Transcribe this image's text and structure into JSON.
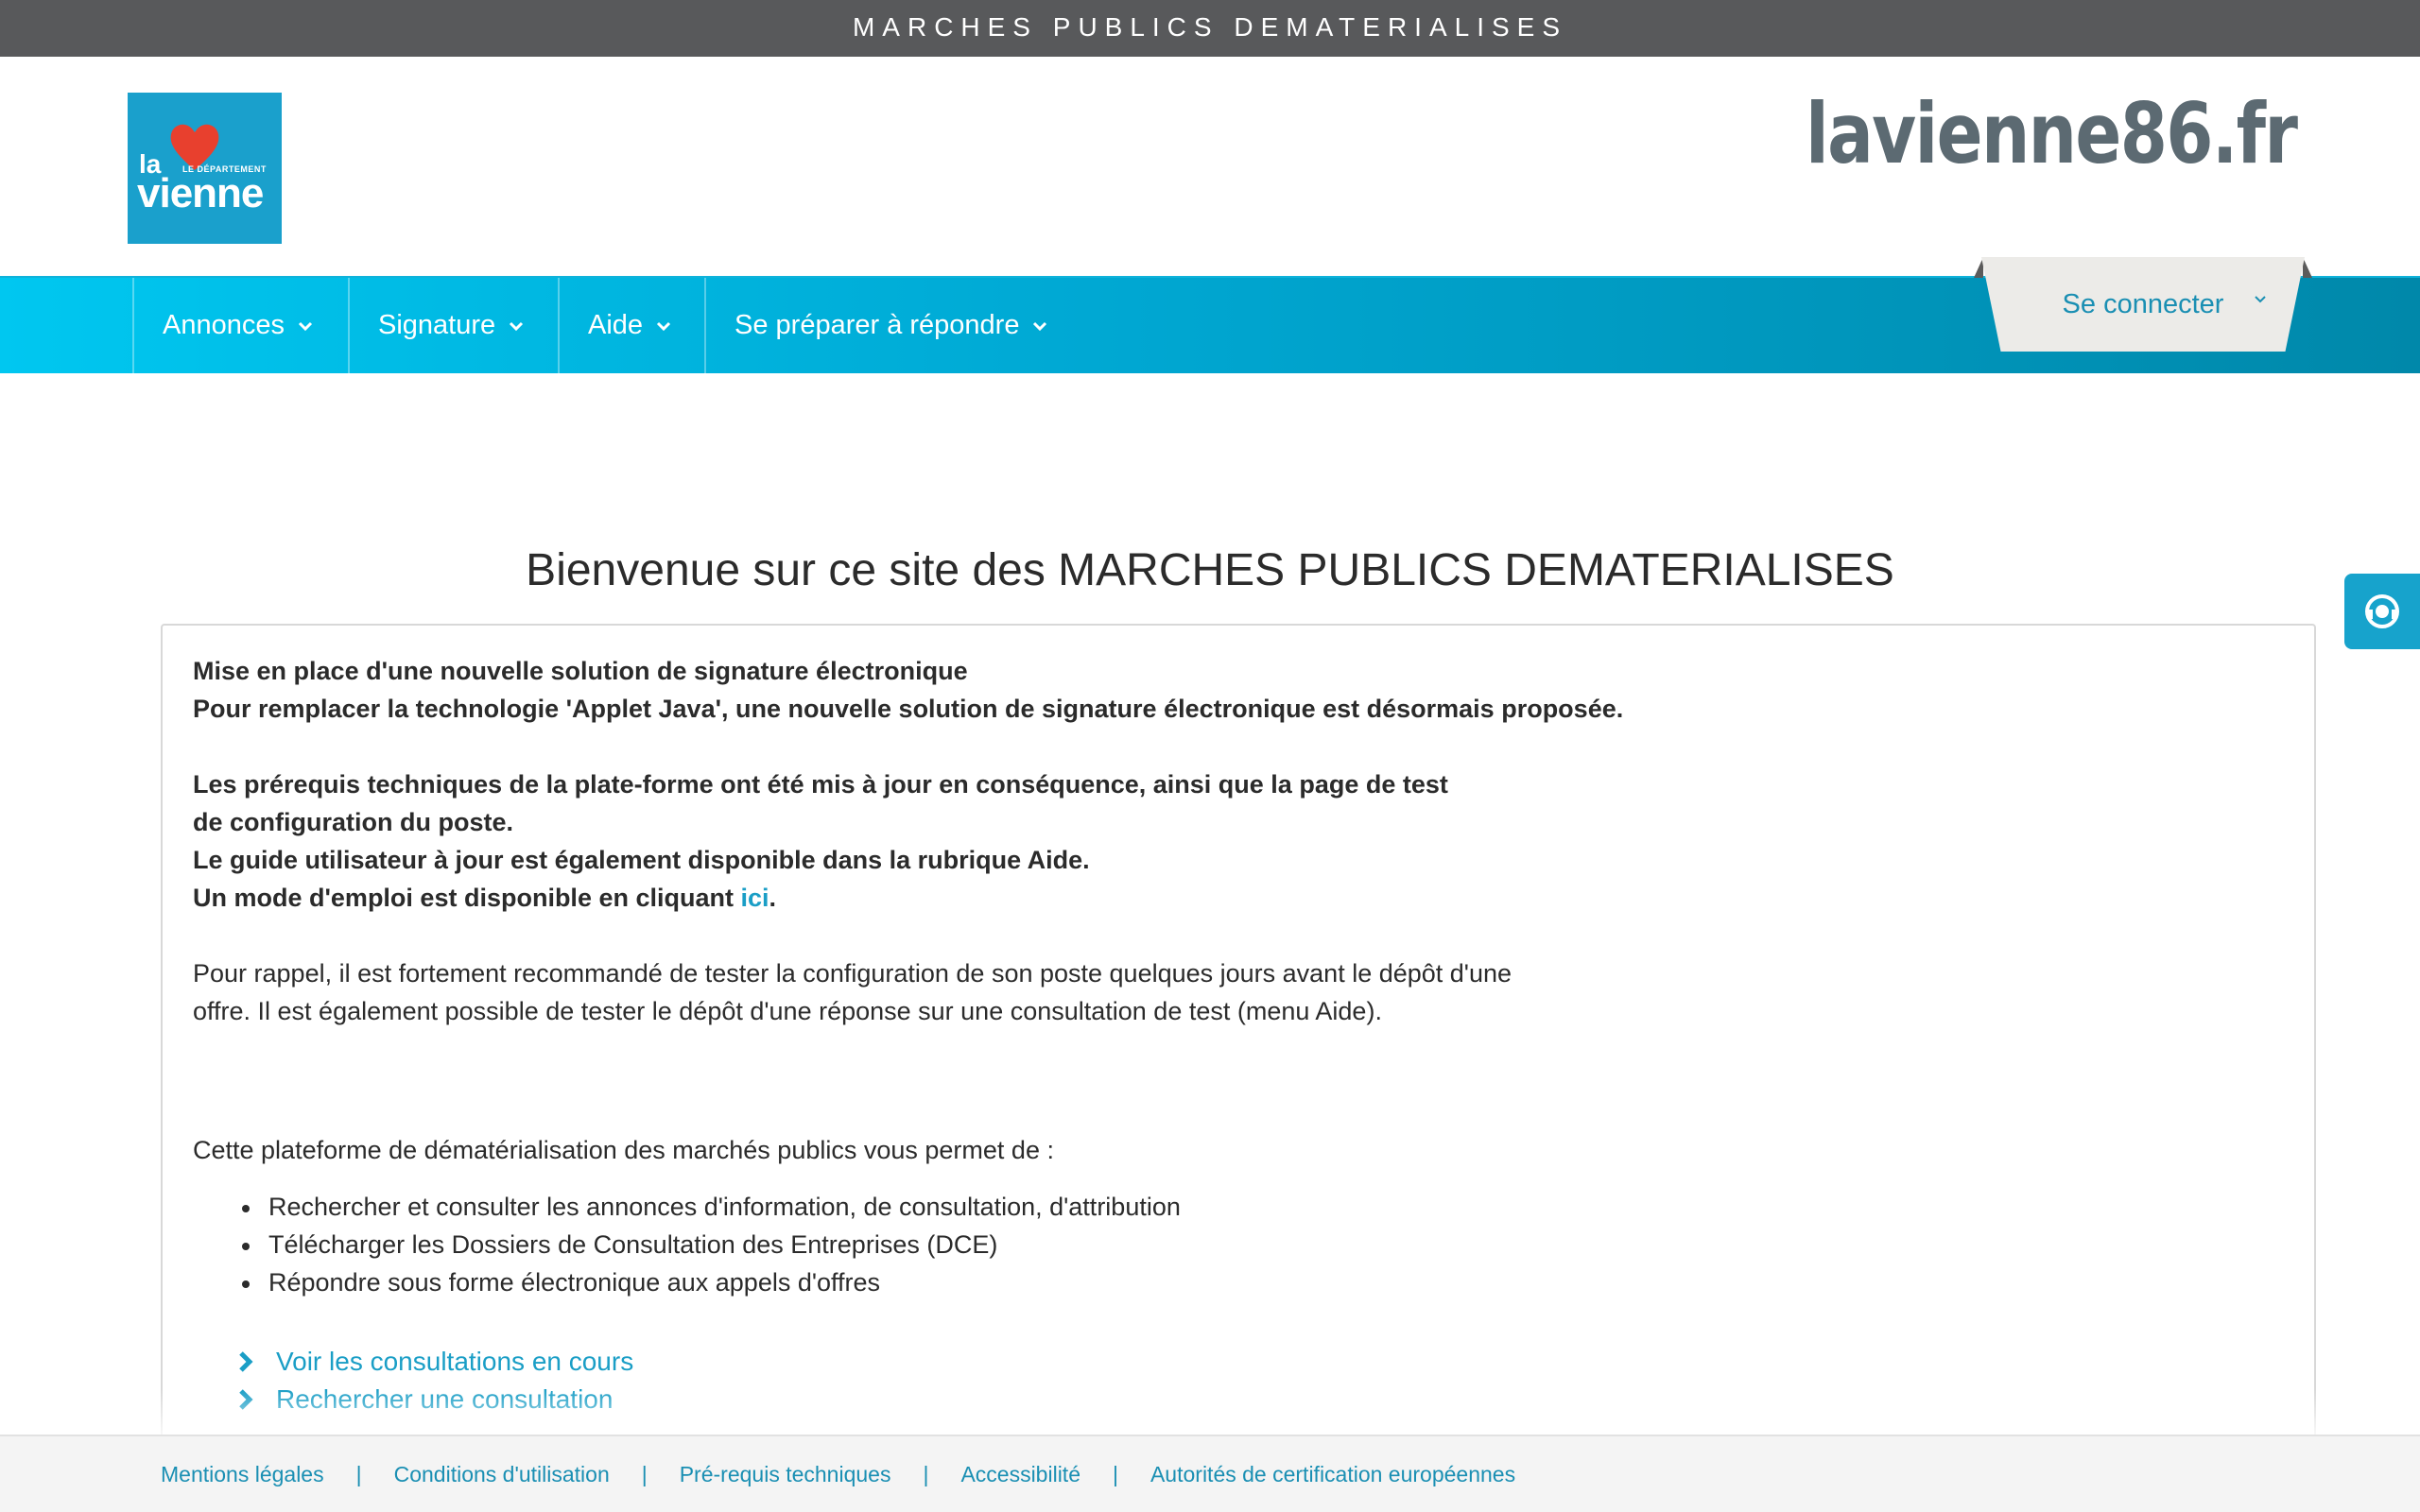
{
  "topbar": {
    "title": "MARCHES PUBLICS DEMATERIALISES"
  },
  "logo": {
    "line1": "la",
    "line2": "vienne",
    "tag": "LE DÉPARTEMENT"
  },
  "site_url": "lavienne86.fr",
  "nav": {
    "items": [
      {
        "label": "Annonces"
      },
      {
        "label": "Signature"
      },
      {
        "label": "Aide"
      },
      {
        "label": "Se préparer à répondre"
      }
    ],
    "connect_label": "Se connecter"
  },
  "main": {
    "title": "Bienvenue sur ce site des MARCHES PUBLICS DEMATERIALISES",
    "notice": {
      "line1": "Mise en place d'une nouvelle solution de signature électronique",
      "line2": "Pour remplacer la technologie 'Applet Java', une nouvelle solution de signature électronique est désormais proposée.",
      "line3": "Les prérequis techniques de la plate-forme ont été mis à jour en conséquence, ainsi que la page de test de configuration du poste.",
      "line4": "Le guide utilisateur à jour est également disponible dans la rubrique Aide.",
      "line5_prefix": "Un mode d'emploi est disponible en cliquant ",
      "line5_link": "ici",
      "line5_suffix": "."
    },
    "reminder": "Pour rappel, il est fortement recommandé de tester la configuration de son poste quelques jours avant le dépôt d'une offre. Il est également possible de tester le dépôt d'une réponse sur une consultation de test (menu Aide).",
    "intro": "Cette plateforme de dématérialisation des marchés publics vous permet de :",
    "features": [
      "Rechercher et consulter les annonces d'information, de consultation, d'attribution",
      "Télécharger les Dossiers de Consultation des Entreprises (DCE)",
      "Répondre sous forme électronique aux appels d'offres"
    ],
    "links": [
      {
        "label": "Voir les consultations en cours"
      },
      {
        "label": "Rechercher une consultation"
      }
    ]
  },
  "footer": {
    "links": [
      "Mentions légales",
      "Conditions d'utilisation",
      "Pré-requis techniques",
      "Accessibilité",
      "Autorités de certification européennes"
    ],
    "separator": "|"
  },
  "colors": {
    "topbar": "#58595b",
    "accent": "#1a9ec6",
    "nav_start": "#00c7f0",
    "nav_end": "#0088aa",
    "logo_bg": "#1aa0cc",
    "heart": "#e8402e"
  },
  "icons": {
    "nav_chevron": "chevron-down-icon",
    "link_arrow": "chevron-right-icon",
    "side_tab": "help-support-icon"
  }
}
